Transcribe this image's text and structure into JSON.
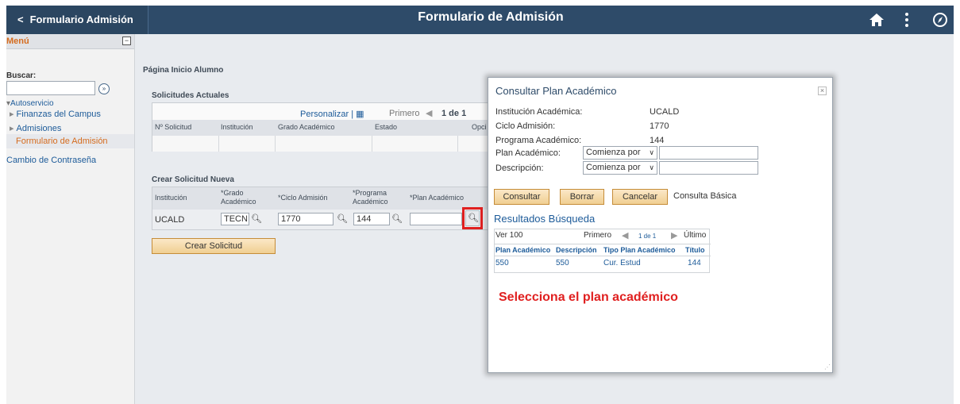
{
  "header": {
    "back_label": "Formulario Admisión",
    "title": "Formulario de Admisión",
    "icons": [
      "home-icon",
      "more-vertical-icon",
      "navigator-compass-icon"
    ]
  },
  "sidebar": {
    "menu_title": "Menú",
    "collapse_symbol": "−",
    "search_label": "Buscar:",
    "search_value": "",
    "search_go": "»",
    "items": [
      {
        "label": "Autoservicio",
        "prefix": "▾"
      },
      {
        "label": "Finanzas del Campus",
        "prefix": "▸"
      },
      {
        "label": "Admisiones",
        "prefix": "▸"
      },
      {
        "label": "Formulario de Admisión",
        "prefix": ""
      },
      {
        "label": "Cambio de Contraseña",
        "prefix": ""
      }
    ]
  },
  "page": {
    "page_link": "Página Inicio Alumno",
    "current": {
      "title": "Solicitudes Actuales",
      "personalize": "Personalizar",
      "first": "Primero",
      "pager": "1 de 1",
      "columns": [
        "Nº Solicitud",
        "Institución",
        "Grado Académico",
        "Estado",
        "Opci"
      ]
    },
    "new": {
      "title": "Crear Solicitud Nueva",
      "columns": [
        "Institución",
        "*Grado Académico",
        "*Ciclo Admisión",
        "*Programa Académico",
        "*Plan Académico"
      ],
      "institution": "UCALD",
      "grade": "TECN",
      "cycle": "1770",
      "program": "144",
      "plan": "",
      "create_button": "Crear Solicitud"
    }
  },
  "modal": {
    "title": "Consultar Plan Académico",
    "close": "×",
    "fields": [
      {
        "label": "Institución Académica:",
        "value": "UCALD"
      },
      {
        "label": "Ciclo Admisión:",
        "value": "1770"
      },
      {
        "label": "Programa Académico:",
        "value": "144"
      }
    ],
    "plan_label": "Plan Académico:",
    "plan_operator": "Comienza por",
    "plan_value": "",
    "desc_label": "Descripción:",
    "desc_operator": "Comienza por",
    "desc_value": "",
    "buttons": {
      "search": "Consultar",
      "clear": "Borrar",
      "cancel": "Cancelar"
    },
    "basic_link": "Consulta Básica",
    "results_title": "Resultados Búsqueda",
    "results": {
      "view": "Ver 100",
      "first": "Primero",
      "pager": "1 de 1",
      "last": "Último",
      "columns": [
        "Plan Académico",
        "Descripción",
        "Tipo Plan Académico",
        "Título"
      ],
      "rows": [
        {
          "plan": "550",
          "description": "550",
          "type": "Cur. Estud",
          "title": "144"
        }
      ]
    },
    "instruction": "Selecciona el plan académico"
  },
  "colors": {
    "header_bg": "#2e4b69",
    "highlight_box": "#e02020",
    "instruction_text": "#e02020",
    "button_bg": "#f0cf92"
  }
}
